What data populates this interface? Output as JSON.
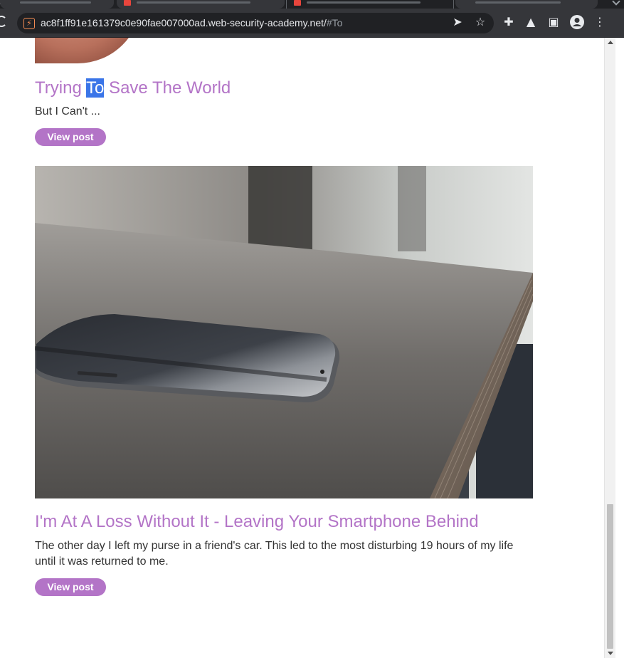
{
  "browser": {
    "url_main": "ac8f1ff91e161379c0e90fae007000ad.web-security-academy.net/",
    "url_fragment": "#To"
  },
  "posts": [
    {
      "title_before": "Trying ",
      "title_highlight": "To",
      "title_after": " Save The World",
      "excerpt": "But I Can't ...",
      "button": "View post"
    },
    {
      "title": "I'm At A Loss Without It - Leaving Your Smartphone Behind",
      "excerpt": "The other day I left my purse in a friend's car. This led to the most disturbing 19 hours of my life until it was returned to me.",
      "button": "View post"
    }
  ],
  "colors": {
    "accent": "#b374c7",
    "text_highlight": "#3a75e8",
    "chrome_dark": "#35363a"
  },
  "icons": [
    "reload-icon",
    "site-info-icon",
    "send-icon",
    "star-icon",
    "extensions-icon",
    "labs-icon",
    "side-panel-icon",
    "profile-icon",
    "menu-icon"
  ]
}
